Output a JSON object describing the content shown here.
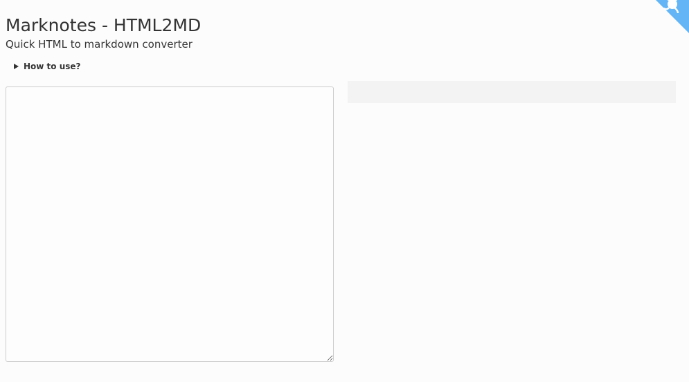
{
  "header": {
    "title": "Marknotes - HTML2MD",
    "subtitle": "Quick HTML to markdown converter"
  },
  "how_to": {
    "label": "How to use?"
  },
  "input": {
    "value": "",
    "placeholder": ""
  },
  "output": {
    "value": ""
  },
  "corner_badge": {
    "icon": "github-octocat-icon",
    "color": "#64b5f6"
  },
  "colors": {
    "background": "#fcfcfc",
    "text": "#333333",
    "output_background": "#f3f3f3",
    "input_border": "#cccccc",
    "accent": "#64b5f6"
  }
}
